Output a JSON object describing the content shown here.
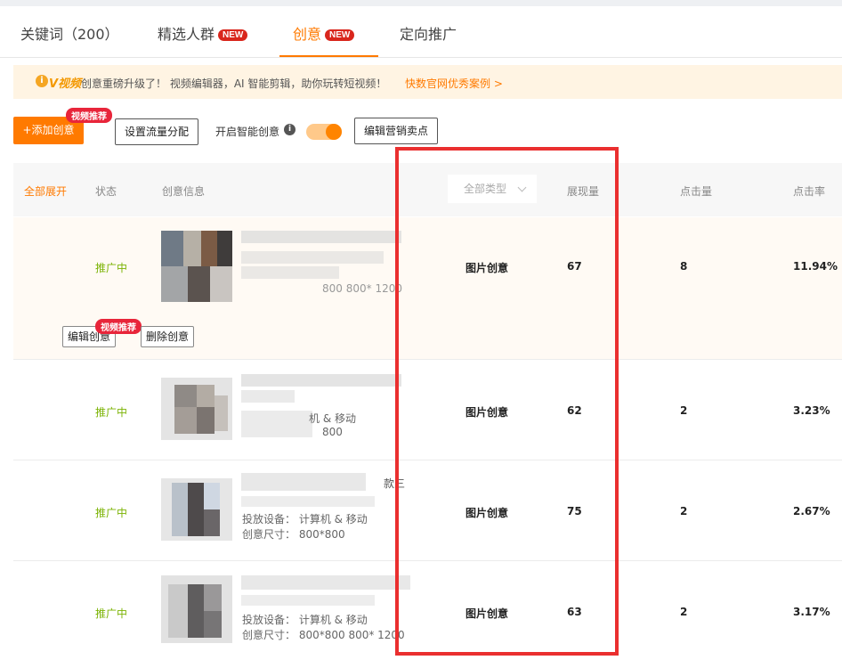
{
  "tabs": [
    {
      "label": "关键词（200）",
      "badge": ""
    },
    {
      "label": "精选人群",
      "badge": "NEW"
    },
    {
      "label": "创意",
      "badge": "NEW",
      "active": true
    },
    {
      "label": "定向推广",
      "badge": ""
    }
  ],
  "notice": {
    "icon": "info-icon",
    "logo": "V视频",
    "text": "创意重磅升级了！ 视频编辑器，AI 智能剪辑，助你玩转短视频！",
    "link": "快数官网优秀案例 >"
  },
  "toolbar": {
    "add_label": "+添加创意",
    "add_badge": "视频推荐",
    "flow_label": "设置流量分配",
    "smart_label": "开启智能创意",
    "smart_enabled": true,
    "selling_label": "编辑营销卖点"
  },
  "table": {
    "expand_all": "全部展开",
    "headers": {
      "status": "状态",
      "info": "创意信息",
      "type_filter": "全部类型",
      "impressions": "展现量",
      "clicks": "点击量",
      "ctr": "点击率"
    },
    "rows": [
      {
        "status": "推广中",
        "size_text": "800 800* 1200",
        "device_text": "",
        "type": "图片创意",
        "impressions": "67",
        "clicks": "8",
        "ctr": "11.94%"
      },
      {
        "status": "推广中",
        "device_text": "机 & 移动",
        "size_text": "800",
        "type": "图片创意",
        "impressions": "62",
        "clicks": "2",
        "ctr": "3.23%"
      },
      {
        "status": "推广中",
        "title_tail": "款三",
        "device_text": "投放设备：   计算机 & 移动",
        "size_text": "创意尺寸：   800*800",
        "type": "图片创意",
        "impressions": "75",
        "clicks": "2",
        "ctr": "2.67%"
      },
      {
        "status": "推广中",
        "device_text": "投放设备：   计算机 & 移动",
        "size_text": "创意尺寸：   800*800 800* 1200",
        "type": "图片创意",
        "impressions": "63",
        "clicks": "2",
        "ctr": "3.17%"
      }
    ],
    "row_actions": {
      "edit": "编辑创意",
      "edit_badge": "视频推荐",
      "delete": "删除创意"
    }
  },
  "colors": {
    "accent": "#ff7a00",
    "status_green": "#7cb305",
    "highlight_red": "#ea2f2f",
    "badge_red": "#d9261c"
  }
}
